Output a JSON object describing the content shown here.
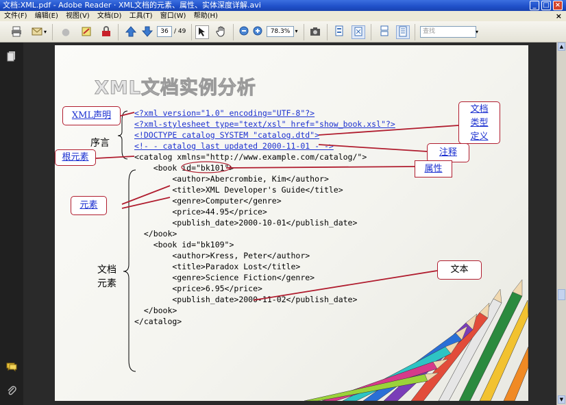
{
  "window": {
    "title": "文档:XML.pdf - Adobe Reader  ·  XML文档的元素、属性、实体深度详解.avi",
    "minimize": "_",
    "maximize": "□",
    "close": "×"
  },
  "menu": {
    "items": [
      "文件(F)",
      "编辑(E)",
      "视图(V)",
      "文档(D)",
      "工具(T)",
      "窗口(W)",
      "帮助(H)"
    ],
    "close_glyph": "×"
  },
  "toolbar": {
    "page_current": "36",
    "page_total": "/ 49",
    "zoom": "78.3%",
    "search_placeholder": "查找"
  },
  "slide": {
    "title": "XML文档实例分析",
    "code_lines": [
      "<?xml version=\"1.0\" encoding=\"UTF-8\"?>",
      "<?xml-stylesheet type=\"text/xsl\" href=\"show_book.xsl\"?>",
      "<!DOCTYPE catalog SYSTEM \"catalog.dtd\">",
      "<!- - catalog last updated 2000-11-01 - ->",
      "<catalog xmlns=\"http://www.example.com/catalog/\">",
      "    <book id=\"bk101\">",
      "        <author>Abercrombie, Kim</author>",
      "        <title>XML Developer's Guide</title>",
      "        <genre>Computer</genre>",
      "        <price>44.95</price>",
      "        <publish_date>2000-10-01</publish_date>",
      "  </book>",
      "    <book id=\"bk109\">",
      "        <author>Kress, Peter</author>",
      "        <title>Paradox Lost</title>",
      "        <genre>Science Fiction</genre>",
      "        <price>6.95</price>",
      "        <publish_date>2000-11-02</publish_date>",
      "  </book>",
      "</catalog>"
    ],
    "labels": {
      "prolog": "序言",
      "doc_elements_1": "文档",
      "doc_elements_2": "元素"
    },
    "callouts": {
      "xml_declaration": "XML声明",
      "root_element": "根元素",
      "element": "元素",
      "doctype_1": "文档",
      "doctype_2": "类型",
      "doctype_3": "定义",
      "comment": "注释",
      "attribute": "属性",
      "text": "文本"
    }
  }
}
